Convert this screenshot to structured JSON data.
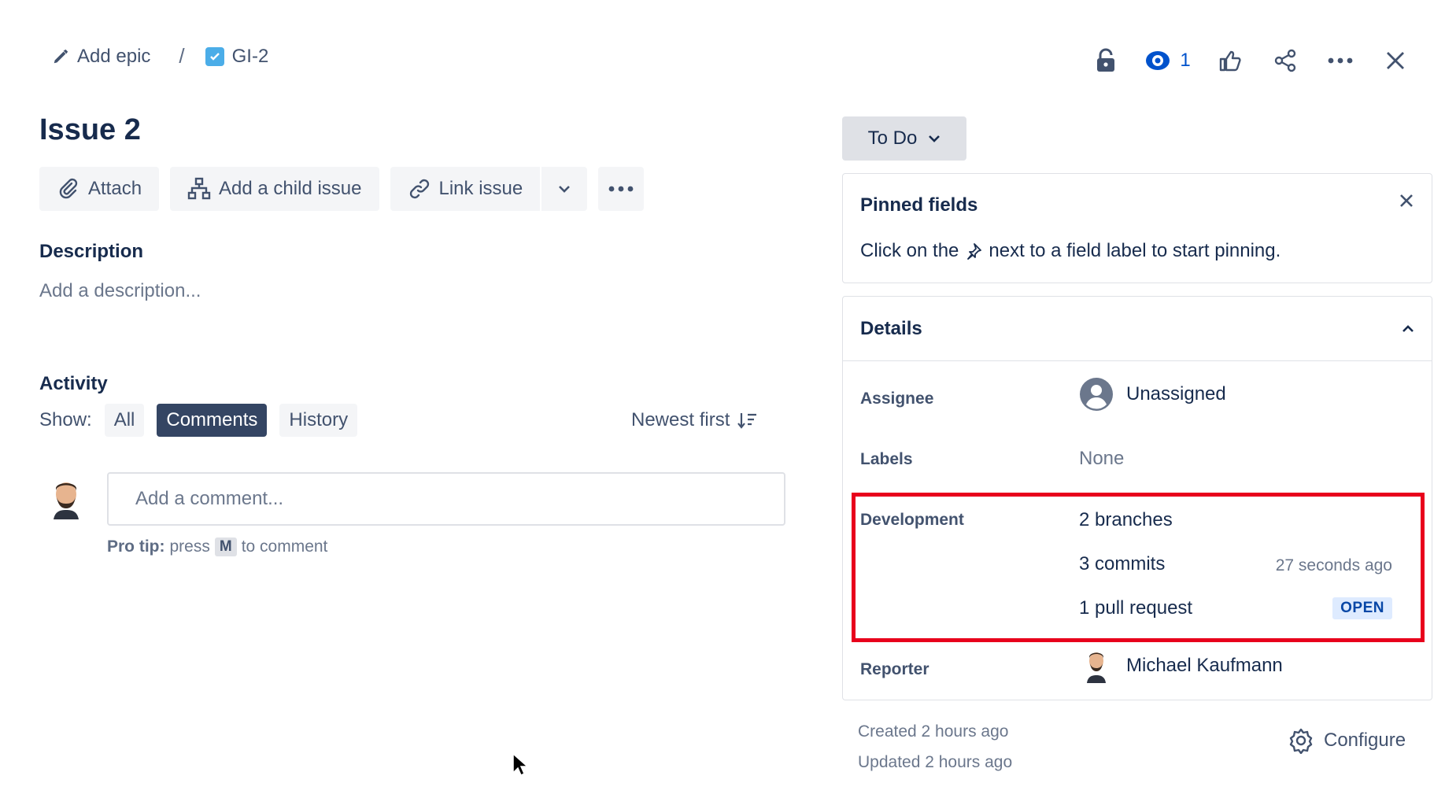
{
  "breadcrumb": {
    "epic_label": "Add epic",
    "separator": "/",
    "issue_key": "GI-2"
  },
  "header": {
    "watch_count": "1"
  },
  "issue": {
    "title": "Issue 2"
  },
  "actions": {
    "attach": "Attach",
    "add_child": "Add a child issue",
    "link_issue": "Link issue"
  },
  "description": {
    "label": "Description",
    "placeholder": "Add a description..."
  },
  "activity": {
    "label": "Activity",
    "show_label": "Show:",
    "filters": [
      "All",
      "Comments",
      "History"
    ],
    "active_filter": "Comments",
    "sort_label": "Newest first",
    "comment_placeholder": "Add a comment...",
    "protip_label": "Pro tip:",
    "protip_pre": "press",
    "protip_key": "M",
    "protip_post": "to comment"
  },
  "status": {
    "label": "To Do"
  },
  "pinned": {
    "title": "Pinned fields",
    "text_pre": "Click on the",
    "text_post": "next to a field label to start pinning."
  },
  "details": {
    "title": "Details",
    "assignee_label": "Assignee",
    "assignee_value": "Unassigned",
    "labels_label": "Labels",
    "labels_value": "None",
    "development_label": "Development",
    "branches": "2 branches",
    "commits": "3 commits",
    "commits_time": "27 seconds ago",
    "pull_request": "1 pull request",
    "pr_status": "OPEN",
    "reporter_label": "Reporter",
    "reporter_value": "Michael Kaufmann"
  },
  "meta": {
    "created": "Created 2 hours ago",
    "updated": "Updated 2 hours ago",
    "configure": "Configure"
  },
  "colors": {
    "active_pill": "#344563",
    "highlight": "#e8001c",
    "watch": "#0052cc",
    "lozenge_bg": "#deebff",
    "lozenge_text": "#0747a6"
  }
}
